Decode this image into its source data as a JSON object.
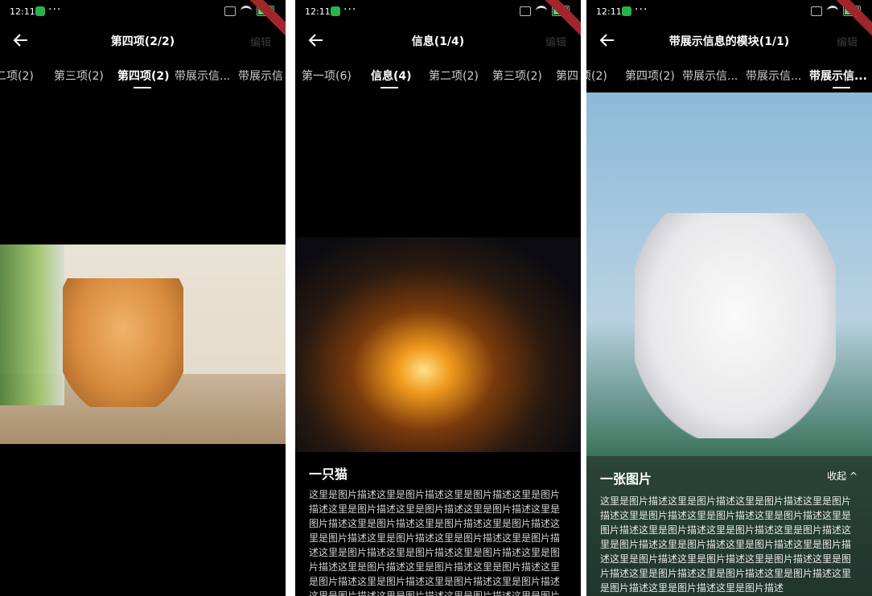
{
  "screens": [
    {
      "status": {
        "time": "12:11"
      },
      "nav": {
        "title": "第四项(2/2)",
        "edit": "编辑"
      },
      "tabs": [
        "二项(2)",
        "第三项(2)",
        "第四项(2)",
        "带展示信...",
        "带展示信"
      ]
    },
    {
      "status": {
        "time": "12:11"
      },
      "nav": {
        "title": "信息(1/4)",
        "edit": "编辑"
      },
      "tabs": [
        "第一项(6)",
        "信息(4)",
        "第二项(2)",
        "第三项(2)",
        "第四"
      ],
      "caption": {
        "title": "一只猫",
        "text": "这里是图片描述这里是图片描述这里是图片描述这里是图片描述这里是图片描述这里是图片描述这里是图片描述这里是图片描述这里是图片描述这里是图片描述这里是图片描述这里是图片描述这里是图片描述这里是图片描述这里是图片描述这里是图片描述这里是图片描述这里是图片描述这里是图片描述这里是图片描述这里是图片描述这里是图片描述这里是图片描述这里是图片描述这里是图片描述这里是图片描述这里是图片描述这里是图片描述这里是图片描述这里是图片描述这里是图片描述这里是图片描述"
      }
    },
    {
      "status": {
        "time": "12:11"
      },
      "nav": {
        "title": "带展示信息的模块(1/1)",
        "edit": "编辑"
      },
      "tabs": [
        "项(2)",
        "第四项(2)",
        "带展示信...",
        "带展示信...",
        "带展示信..."
      ],
      "caption": {
        "title": "一张图片",
        "collapse": "收起 ^",
        "text": "这里是图片描述这里是图片描述这里是图片描述这里是图片描述这里是图片描述这里是图片描述这里是图片描述这里是图片描述这里是图片描述这里是图片描述这里是图片描述这里是图片描述这里是图片描述这里是图片描述这里是图片描述这里是图片描述这里是图片描述这里是图片描述这里是图片描述这里是图片描述这里是图片描述这里是图片描述这里是图片描述这里是图片描述这里是图片描述"
      }
    }
  ]
}
